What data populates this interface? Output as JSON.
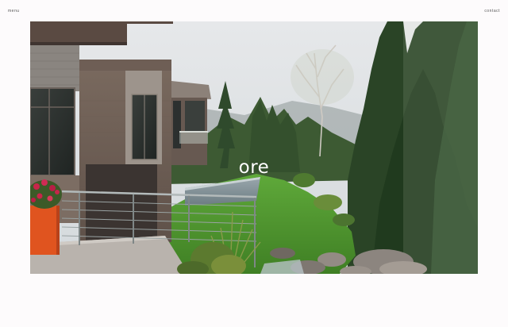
{
  "nav": {
    "menu_label": "menu",
    "contact_label": "contact"
  },
  "hero": {
    "logo_text": "ore"
  },
  "colors": {
    "background": "#fdfbfc",
    "planter": "#e0541f",
    "lawn": "#4f9a2e",
    "sky": "#dfe3e6"
  }
}
